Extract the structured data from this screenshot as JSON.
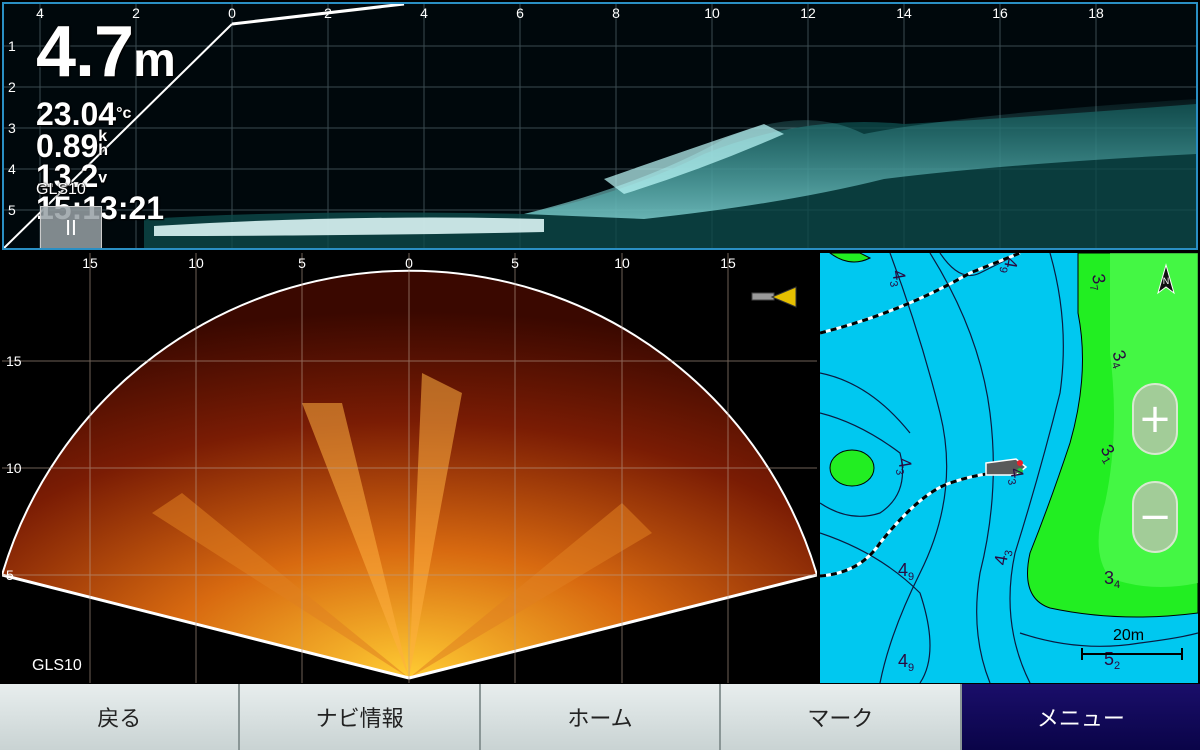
{
  "top_sonar": {
    "range_ticks": [
      "4",
      "2",
      "0",
      "2",
      "4",
      "6",
      "8",
      "10",
      "12",
      "14",
      "16",
      "18"
    ],
    "depth_ticks": [
      "1",
      "2",
      "3",
      "4",
      "5"
    ],
    "depth": "4.7",
    "depth_unit": "m",
    "temperature": "23.04",
    "temperature_unit": "°c",
    "speed": "0.89",
    "speed_unit_top": "k",
    "speed_unit_bottom": "h",
    "voltage": "13.2",
    "voltage_unit": "v",
    "time": "15:13:21",
    "source": "GLS10",
    "pause_icon": "pause-icon",
    "pause_label": "II"
  },
  "bottom_sonar": {
    "range_ticks": [
      "15",
      "10",
      "5",
      "0",
      "5",
      "10",
      "15"
    ],
    "depth_ticks": [
      "15",
      "10",
      "5"
    ],
    "source": "GLS10",
    "transducer_icon": "transducer-icon"
  },
  "map": {
    "north_icon": "north-arrow-icon",
    "north_label": "N",
    "zoom_in_label": "+",
    "zoom_out_label": "−",
    "scale_label": "20m",
    "depth_labels": [
      {
        "main": "4",
        "sub": "3"
      },
      {
        "main": "4",
        "sub": "9"
      },
      {
        "main": "3",
        "sub": "7"
      },
      {
        "main": "3",
        "sub": "4"
      },
      {
        "main": "3",
        "sub": "1"
      },
      {
        "main": "4",
        "sub": "3"
      },
      {
        "main": "4",
        "sub": "3"
      },
      {
        "main": "4",
        "sub": "9"
      },
      {
        "main": "4",
        "sub": "3"
      },
      {
        "main": "3",
        "sub": "4"
      },
      {
        "main": "4",
        "sub": "9"
      },
      {
        "main": "5",
        "sub": "2"
      }
    ]
  },
  "nav": {
    "back": "戻る",
    "navi_info": "ナビ情報",
    "home": "ホーム",
    "mark": "マーク",
    "menu": "メニュー"
  },
  "colors": {
    "frame": "#2a8fc4",
    "sonar_top_echo": "#5fe0e0",
    "sonar_bottom_echo": "#ff9a1a",
    "map_water": "#00c8f0",
    "map_shallow": "#22ee22",
    "menu_bg": "#120a5c"
  }
}
